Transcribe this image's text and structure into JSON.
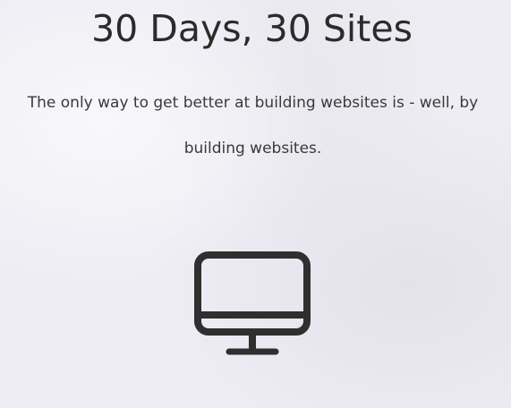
{
  "hero": {
    "title": "30 Days, 30 Sites",
    "subtitle": "The only way to get better at building websites is - well, by building websites.",
    "icon": "desktop-monitor-icon"
  }
}
